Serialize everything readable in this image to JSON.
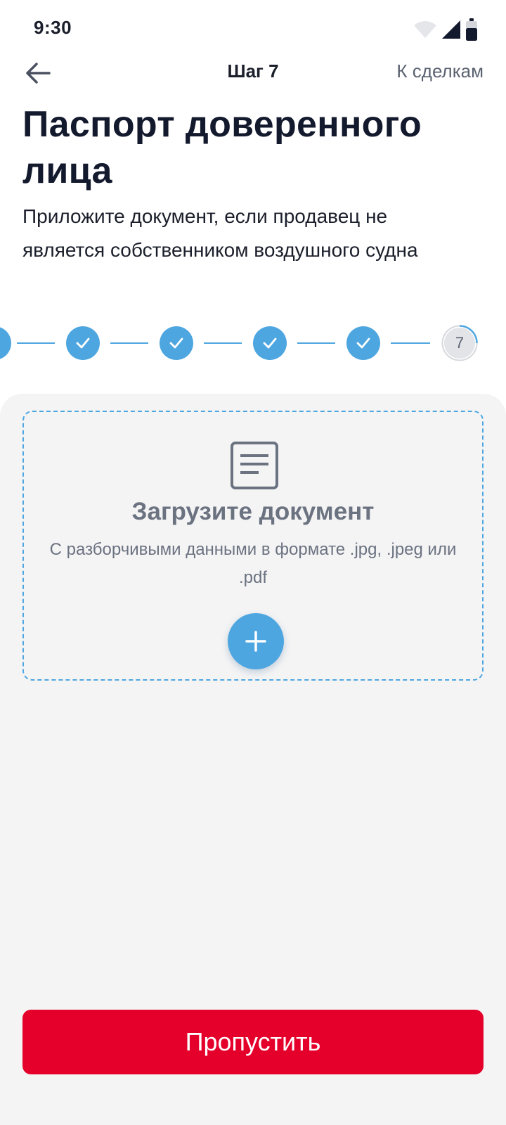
{
  "status_bar": {
    "time": "9:30",
    "icons": [
      "wifi-icon",
      "signal-icon",
      "battery-icon"
    ]
  },
  "app_bar": {
    "back_icon": "arrow-left-icon",
    "step_label": "Шаг 7",
    "deals_link": "К сделкам"
  },
  "header": {
    "title": "Паспорт доверенного лица",
    "subtitle": "Приложите документ, если продавец не является собственником воздушного судна"
  },
  "stepper": {
    "completed_steps": 6,
    "current_step": "7",
    "total_steps": 7
  },
  "upload": {
    "icon": "document-icon",
    "title": "Загрузите документ",
    "hint": "С разборчивыми данными в формате .jpg, .jpeg или .pdf",
    "add_icon": "plus-icon"
  },
  "actions": {
    "skip_label": "Пропустить"
  },
  "colors": {
    "accent": "#4ea6e0",
    "primary_button": "#e4002b",
    "title_text": "#141a2e",
    "muted_text": "#6b7280",
    "sheet_background": "#f4f4f5"
  }
}
